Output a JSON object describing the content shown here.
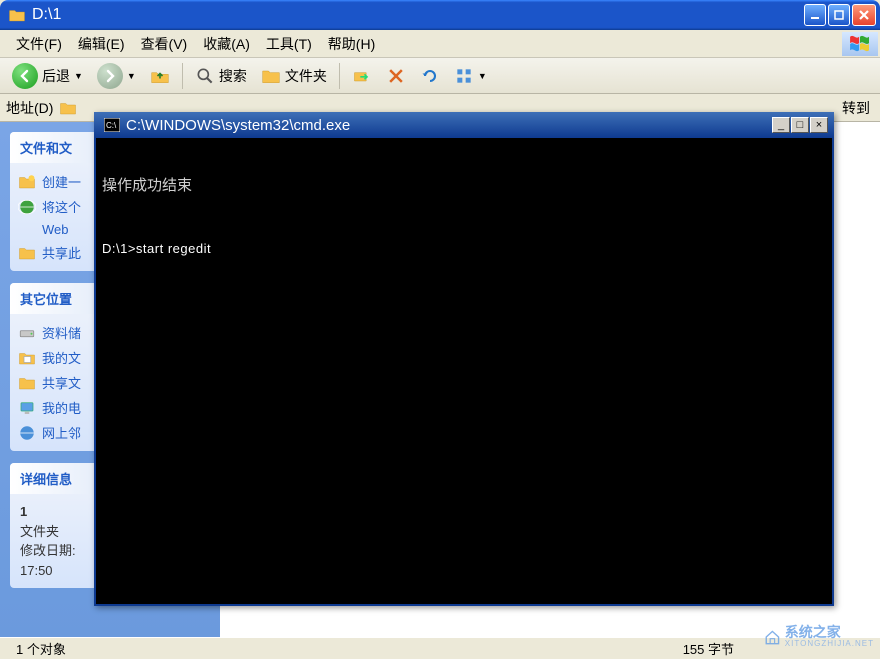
{
  "explorer": {
    "title": "D:\\1",
    "minimize_tip": "min",
    "maximize_tip": "max",
    "close_tip": "close"
  },
  "menu": {
    "file": "文件(F)",
    "edit": "编辑(E)",
    "view": "查看(V)",
    "favorites": "收藏(A)",
    "tools": "工具(T)",
    "help": "帮助(H)"
  },
  "toolbar": {
    "back": "后退",
    "search": "搜索",
    "folders": "文件夹"
  },
  "address": {
    "label": "地址(D)",
    "go": "转到"
  },
  "sidebar": {
    "tasks_hdr": "文件和文",
    "tasks": [
      {
        "label": "创建一"
      },
      {
        "label": "将这个"
      },
      {
        "web": "Web"
      },
      {
        "label": "共享此"
      }
    ],
    "other_hdr": "其它位置",
    "places": [
      {
        "label": "资料储"
      },
      {
        "label": "我的文"
      },
      {
        "label": "共享文"
      },
      {
        "label": "我的电"
      },
      {
        "label": "网上邻"
      }
    ],
    "details_hdr": "详细信息",
    "details": {
      "name": "1",
      "type": "文件夹",
      "modified_label": "修改日期:",
      "time": "17:50"
    }
  },
  "status": {
    "left": "1 个对象",
    "right": "155 字节"
  },
  "cmd": {
    "title": " C:\\WINDOWS\\system32\\cmd.exe",
    "line1": "操作成功结束",
    "line2": "D:\\1>start regedit"
  },
  "watermark": {
    "title": "系统之家",
    "sub": "XITONGZHIJIA.NET"
  }
}
